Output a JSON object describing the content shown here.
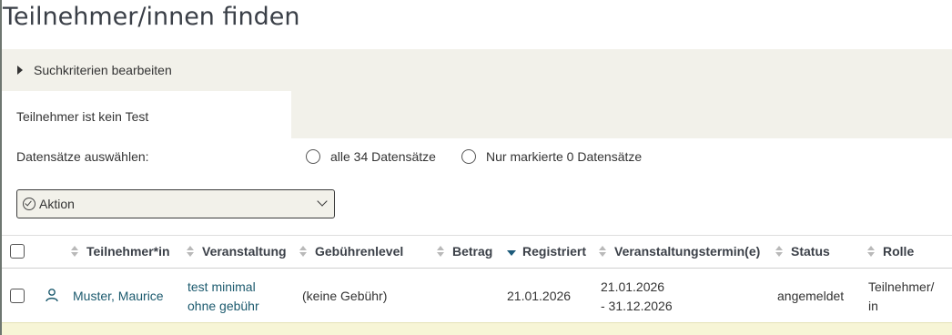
{
  "page": {
    "title": "Teilnehmer/innen finden"
  },
  "criteria": {
    "toggle_label": "Suchkriterien bearbeiten",
    "summary": "Teilnehmer ist kein Test"
  },
  "selection": {
    "label": "Datensätze auswählen:",
    "option_all": "alle 34 Datensätze",
    "option_marked": "Nur markierte 0 Datensätze"
  },
  "action": {
    "label": "Aktion"
  },
  "table": {
    "columns": {
      "participant": "Teilnehmer*in",
      "event": "Veranstaltung",
      "fee_level": "Gebührenlevel",
      "amount": "Betrag",
      "registered": "Registriert",
      "event_dates": "Veranstaltungstermin(e)",
      "status": "Status",
      "role": "Rolle"
    },
    "rows": [
      {
        "participant": "Muster, Maurice",
        "event_line1": "test minimal",
        "event_line2": "ohne gebühr",
        "fee_level": "(keine Gebühr)",
        "amount": "",
        "registered": "21.01.2026",
        "dates_line1": "21.01.2026",
        "dates_line2": "- 31.12.2026",
        "status": "angemeldet",
        "role_line1": "Teilnehmer/",
        "role_line2": "in"
      }
    ]
  },
  "colors": {
    "panel_bg": "#f2f1ea",
    "link": "#1c5a6e",
    "sort_active": "#1c5a7a",
    "row_highlight": "#f7f5d6"
  }
}
